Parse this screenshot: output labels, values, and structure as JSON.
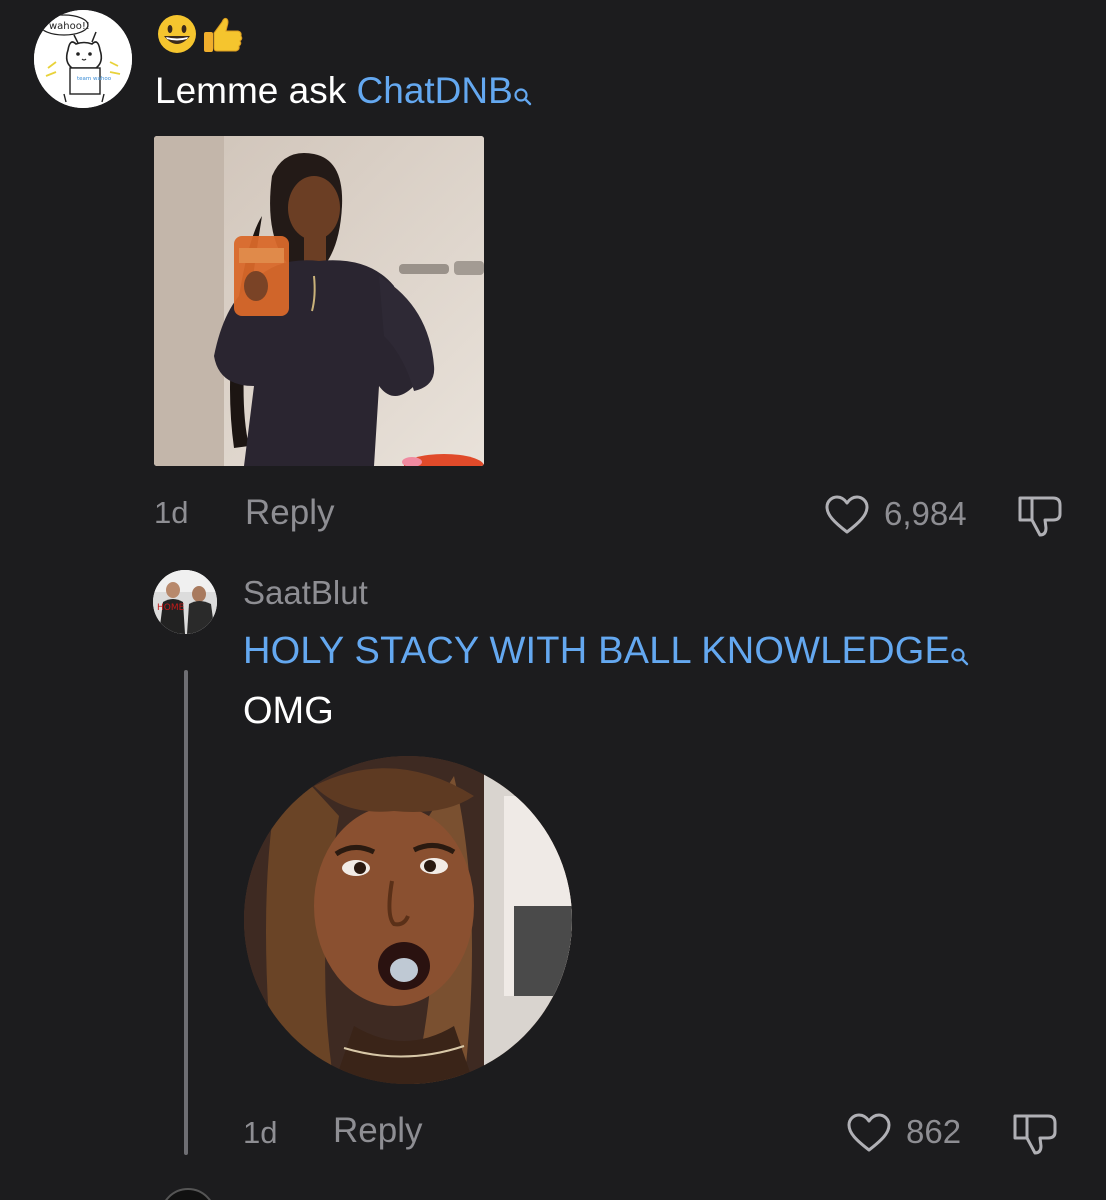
{
  "comment": {
    "emojis": [
      "😃",
      "👍"
    ],
    "text_before": "Lemme ask ",
    "link_text": "ChatDNB",
    "avatar_label": "wahoo!!",
    "avatar_subtext": "team wahoo",
    "gif_image": "woman-holding-drink-gif",
    "time": "1d",
    "reply_label": "Reply",
    "likes": "6,984"
  },
  "reply": {
    "username": "SaatBlut",
    "avatar_text": "HOME",
    "link_text": "HOLY STACY WITH BALL KNOWLEDGE",
    "text": "OMG",
    "gif_image": "surprised-woman-circular-gif",
    "time": "1d",
    "reply_label": "Reply",
    "likes": "862"
  },
  "colors": {
    "background": "#1c1c1e",
    "link": "#64a8f0",
    "muted": "#8e8e93",
    "text": "#ffffff"
  },
  "icons": [
    "search-icon",
    "heart-icon",
    "dislike-icon"
  ]
}
